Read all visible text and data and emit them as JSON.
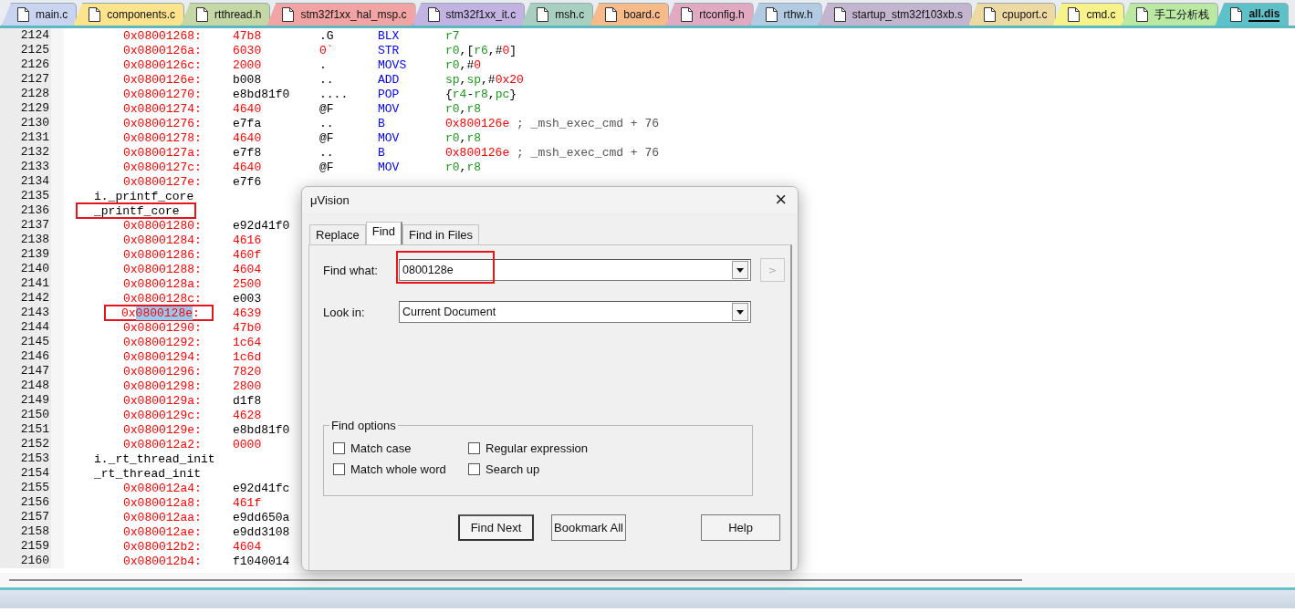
{
  "tabs": [
    {
      "label": "main.c",
      "color": "#c8d4f0",
      "selected": false
    },
    {
      "label": "components.c",
      "color": "#fce38c",
      "selected": false
    },
    {
      "label": "rtthread.h",
      "color": "#c6d7a6",
      "selected": false
    },
    {
      "label": "stm32f1xx_hal_msp.c",
      "color": "#f2a4a4",
      "selected": false
    },
    {
      "label": "stm32f1xx_it.c",
      "color": "#c3b3e3",
      "selected": false
    },
    {
      "label": "msh.c",
      "color": "#a9cfc0",
      "selected": false
    },
    {
      "label": "board.c",
      "color": "#f7bb8a",
      "selected": false
    },
    {
      "label": "rtconfig.h",
      "color": "#e2aac2",
      "selected": false
    },
    {
      "label": "rthw.h",
      "color": "#b3cbe2",
      "selected": false
    },
    {
      "label": "startup_stm32f103xb.s",
      "color": "#c3b4cf",
      "selected": false
    },
    {
      "label": "cpuport.c",
      "color": "#eddaa2",
      "selected": false
    },
    {
      "label": "cmd.c",
      "color": "#f7f28a",
      "selected": false
    },
    {
      "label": "手工分析栈",
      "color": "#bbe9a3",
      "selected": false
    },
    {
      "label": "all.dis",
      "color": "#5cc1c9",
      "selected": true
    }
  ],
  "editor": {
    "lines": [
      {
        "number": "2124",
        "kind": "asm",
        "address": "0x08001268:",
        "hex": {
          "text": "47b8",
          "color": "#ff0000"
        },
        "ascii": {
          "text": ".G",
          "kind": "plain"
        },
        "mnemonic": "BLX",
        "operands": [
          {
            "text": "r7",
            "kind": "register"
          }
        ]
      },
      {
        "number": "2125",
        "kind": "asm",
        "address": "0x0800126a:",
        "hex": {
          "text": "6030",
          "color": "#ff0000"
        },
        "ascii": {
          "text": "0`",
          "kind": "number"
        },
        "mnemonic": "STR",
        "operands": [
          {
            "text": "r0",
            "kind": "register"
          },
          {
            "text": ",[",
            "kind": "plain"
          },
          {
            "text": "r6",
            "kind": "register"
          },
          {
            "text": ",#",
            "kind": "plain"
          },
          {
            "text": "0",
            "kind": "number"
          },
          {
            "text": "]",
            "kind": "plain"
          }
        ]
      },
      {
        "number": "2126",
        "kind": "asm",
        "address": "0x0800126c:",
        "hex": {
          "text": "2000",
          "color": "#ff0000"
        },
        "ascii": {
          "text": ".",
          "kind": "plain"
        },
        "mnemonic": "MOVS",
        "operands": [
          {
            "text": "r0",
            "kind": "register"
          },
          {
            "text": ",#",
            "kind": "plain"
          },
          {
            "text": "0",
            "kind": "number"
          }
        ]
      },
      {
        "number": "2127",
        "kind": "asm",
        "address": "0x0800126e:",
        "hex": {
          "text": "b008",
          "color": "#000000"
        },
        "ascii": {
          "text": "..",
          "kind": "plain"
        },
        "mnemonic": "ADD",
        "operands": [
          {
            "text": "sp",
            "kind": "register"
          },
          {
            "text": ",",
            "kind": "plain"
          },
          {
            "text": "sp",
            "kind": "register"
          },
          {
            "text": ",#",
            "kind": "plain"
          },
          {
            "text": "0x20",
            "kind": "number"
          }
        ]
      },
      {
        "number": "2128",
        "kind": "asm",
        "address": "0x08001270:",
        "hex": {
          "text": "e8bd81f0",
          "color": "#000000"
        },
        "ascii": {
          "text": "....",
          "kind": "plain"
        },
        "mnemonic": "POP",
        "operands": [
          {
            "text": "{",
            "kind": "plain"
          },
          {
            "text": "r4",
            "kind": "register"
          },
          {
            "text": "-",
            "kind": "plain"
          },
          {
            "text": "r8",
            "kind": "register"
          },
          {
            "text": ",",
            "kind": "plain"
          },
          {
            "text": "pc",
            "kind": "register"
          },
          {
            "text": "}",
            "kind": "plain"
          }
        ]
      },
      {
        "number": "2129",
        "kind": "asm",
        "address": "0x08001274:",
        "hex": {
          "text": "4640",
          "color": "#ff0000"
        },
        "ascii": {
          "text": "@F",
          "kind": "plain"
        },
        "mnemonic": "MOV",
        "operands": [
          {
            "text": "r0",
            "kind": "register"
          },
          {
            "text": ",",
            "kind": "plain"
          },
          {
            "text": "r8",
            "kind": "register"
          }
        ]
      },
      {
        "number": "2130",
        "kind": "asm",
        "address": "0x08001276:",
        "hex": {
          "text": "e7fa",
          "color": "#000000"
        },
        "ascii": {
          "text": "..",
          "kind": "plain"
        },
        "mnemonic": "B",
        "operands": [
          {
            "text": "0x800126e",
            "kind": "number"
          },
          {
            "text": " ; _msh_exec_cmd + 76",
            "kind": "comment"
          }
        ]
      },
      {
        "number": "2131",
        "kind": "asm",
        "address": "0x08001278:",
        "hex": {
          "text": "4640",
          "color": "#ff0000"
        },
        "ascii": {
          "text": "@F",
          "kind": "plain"
        },
        "mnemonic": "MOV",
        "operands": [
          {
            "text": "r0",
            "kind": "register"
          },
          {
            "text": ",",
            "kind": "plain"
          },
          {
            "text": "r8",
            "kind": "register"
          }
        ]
      },
      {
        "number": "2132",
        "kind": "asm",
        "address": "0x0800127a:",
        "hex": {
          "text": "e7f8",
          "color": "#000000"
        },
        "ascii": {
          "text": "..",
          "kind": "plain"
        },
        "mnemonic": "B",
        "operands": [
          {
            "text": "0x800126e",
            "kind": "number"
          },
          {
            "text": " ; _msh_exec_cmd + 76",
            "kind": "comment"
          }
        ]
      },
      {
        "number": "2133",
        "kind": "asm",
        "address": "0x0800127c:",
        "hex": {
          "text": "4640",
          "color": "#ff0000"
        },
        "ascii": {
          "text": "@F",
          "kind": "plain"
        },
        "mnemonic": "MOV",
        "operands": [
          {
            "text": "r0",
            "kind": "register"
          },
          {
            "text": ",",
            "kind": "plain"
          },
          {
            "text": "r8",
            "kind": "register"
          }
        ]
      },
      {
        "number": "2134",
        "kind": "asm",
        "address": "0x0800127e:",
        "hex": {
          "text": "e7f6",
          "color": "#000000"
        }
      },
      {
        "number": "2135",
        "kind": "label",
        "text": "i._printf_core",
        "boxed": false
      },
      {
        "number": "2136",
        "kind": "label",
        "text": "_printf_core",
        "boxed": true
      },
      {
        "number": "2137",
        "kind": "asm",
        "address": "0x08001280:",
        "hex": {
          "text": "e92d41f0",
          "color": "#000000"
        }
      },
      {
        "number": "2138",
        "kind": "asm",
        "address": "0x08001284:",
        "hex": {
          "text": "4616",
          "color": "#ff0000"
        }
      },
      {
        "number": "2139",
        "kind": "asm",
        "address": "0x08001286:",
        "hex": {
          "text": "460f",
          "color": "#ff0000"
        }
      },
      {
        "number": "2140",
        "kind": "asm",
        "address": "0x08001288:",
        "hex": {
          "text": "4604",
          "color": "#ff0000"
        }
      },
      {
        "number": "2141",
        "kind": "asm",
        "address": "0x0800128a:",
        "hex": {
          "text": "2500",
          "color": "#ff0000"
        }
      },
      {
        "number": "2142",
        "kind": "asm",
        "address": "0x0800128c:",
        "hex": {
          "text": "e003",
          "color": "#000000"
        }
      },
      {
        "number": "2143",
        "kind": "asm",
        "address_parts": [
          {
            "text": "0x",
            "selected": false
          },
          {
            "text": "0800128e",
            "selected": true
          },
          {
            "text": ":",
            "selected": false
          }
        ],
        "boxed": true,
        "hex": {
          "text": "4639",
          "color": "#ff0000"
        }
      },
      {
        "number": "2144",
        "kind": "asm",
        "address": "0x08001290:",
        "hex": {
          "text": "47b0",
          "color": "#ff0000"
        }
      },
      {
        "number": "2145",
        "kind": "asm",
        "address": "0x08001292:",
        "hex": {
          "text": "1c64",
          "color": "#ff0000"
        }
      },
      {
        "number": "2146",
        "kind": "asm",
        "address": "0x08001294:",
        "hex": {
          "text": "1c6d",
          "color": "#ff0000"
        }
      },
      {
        "number": "2147",
        "kind": "asm",
        "address": "0x08001296:",
        "hex": {
          "text": "7820",
          "color": "#ff0000"
        }
      },
      {
        "number": "2148",
        "kind": "asm",
        "address": "0x08001298:",
        "hex": {
          "text": "2800",
          "color": "#ff0000"
        }
      },
      {
        "number": "2149",
        "kind": "asm",
        "address": "0x0800129a:",
        "hex": {
          "text": "d1f8",
          "color": "#000000"
        }
      },
      {
        "number": "2150",
        "kind": "asm",
        "address": "0x0800129c:",
        "hex": {
          "text": "4628",
          "color": "#ff0000"
        }
      },
      {
        "number": "2151",
        "kind": "asm",
        "address": "0x0800129e:",
        "hex": {
          "text": "e8bd81f0",
          "color": "#000000"
        }
      },
      {
        "number": "2152",
        "kind": "asm",
        "address": "0x080012a2:",
        "hex": {
          "text": "0000",
          "color": "#ff0000"
        }
      },
      {
        "number": "2153",
        "kind": "label",
        "text": "i._rt_thread_init",
        "boxed": false
      },
      {
        "number": "2154",
        "kind": "label",
        "text": "_rt_thread_init",
        "boxed": false
      },
      {
        "number": "2155",
        "kind": "asm",
        "address": "0x080012a4:",
        "hex": {
          "text": "e92d41fc",
          "color": "#000000"
        }
      },
      {
        "number": "2156",
        "kind": "asm",
        "address": "0x080012a8:",
        "hex": {
          "text": "461f",
          "color": "#ff0000"
        }
      },
      {
        "number": "2157",
        "kind": "asm",
        "address": "0x080012aa:",
        "hex": {
          "text": "e9dd650a",
          "color": "#000000"
        }
      },
      {
        "number": "2158",
        "kind": "asm",
        "address": "0x080012ae:",
        "hex": {
          "text": "e9dd3108",
          "color": "#000000"
        }
      },
      {
        "number": "2159",
        "kind": "asm",
        "address": "0x080012b2:",
        "hex": {
          "text": "4604",
          "color": "#ff0000"
        }
      },
      {
        "number": "2160",
        "kind": "asm",
        "address": "0x080012b4:",
        "hex": {
          "text": "f1040014",
          "color": "#000000"
        }
      }
    ]
  },
  "dialog": {
    "title": "μVision",
    "close": "×",
    "tabs": [
      {
        "label": "Replace",
        "selected": false
      },
      {
        "label": "Find",
        "selected": true
      },
      {
        "label": "Find in Files",
        "selected": false
      }
    ],
    "fields": [
      {
        "label": "Find what:",
        "value": "0800128e",
        "boxed": true,
        "side_button": ">"
      },
      {
        "label": "Look in:",
        "value": "Current Document",
        "boxed": false
      }
    ],
    "options": {
      "title": "Find options",
      "items": [
        {
          "label": "Match case",
          "checked": false
        },
        {
          "label": "Regular expression",
          "checked": false
        },
        {
          "label": "Match whole word",
          "checked": false
        },
        {
          "label": "Search up",
          "checked": false
        }
      ]
    },
    "buttons": [
      {
        "label": "Find Next",
        "default": true
      },
      {
        "label": "Bookmark All",
        "default": false
      },
      {
        "label": "Help",
        "default": false
      }
    ]
  }
}
